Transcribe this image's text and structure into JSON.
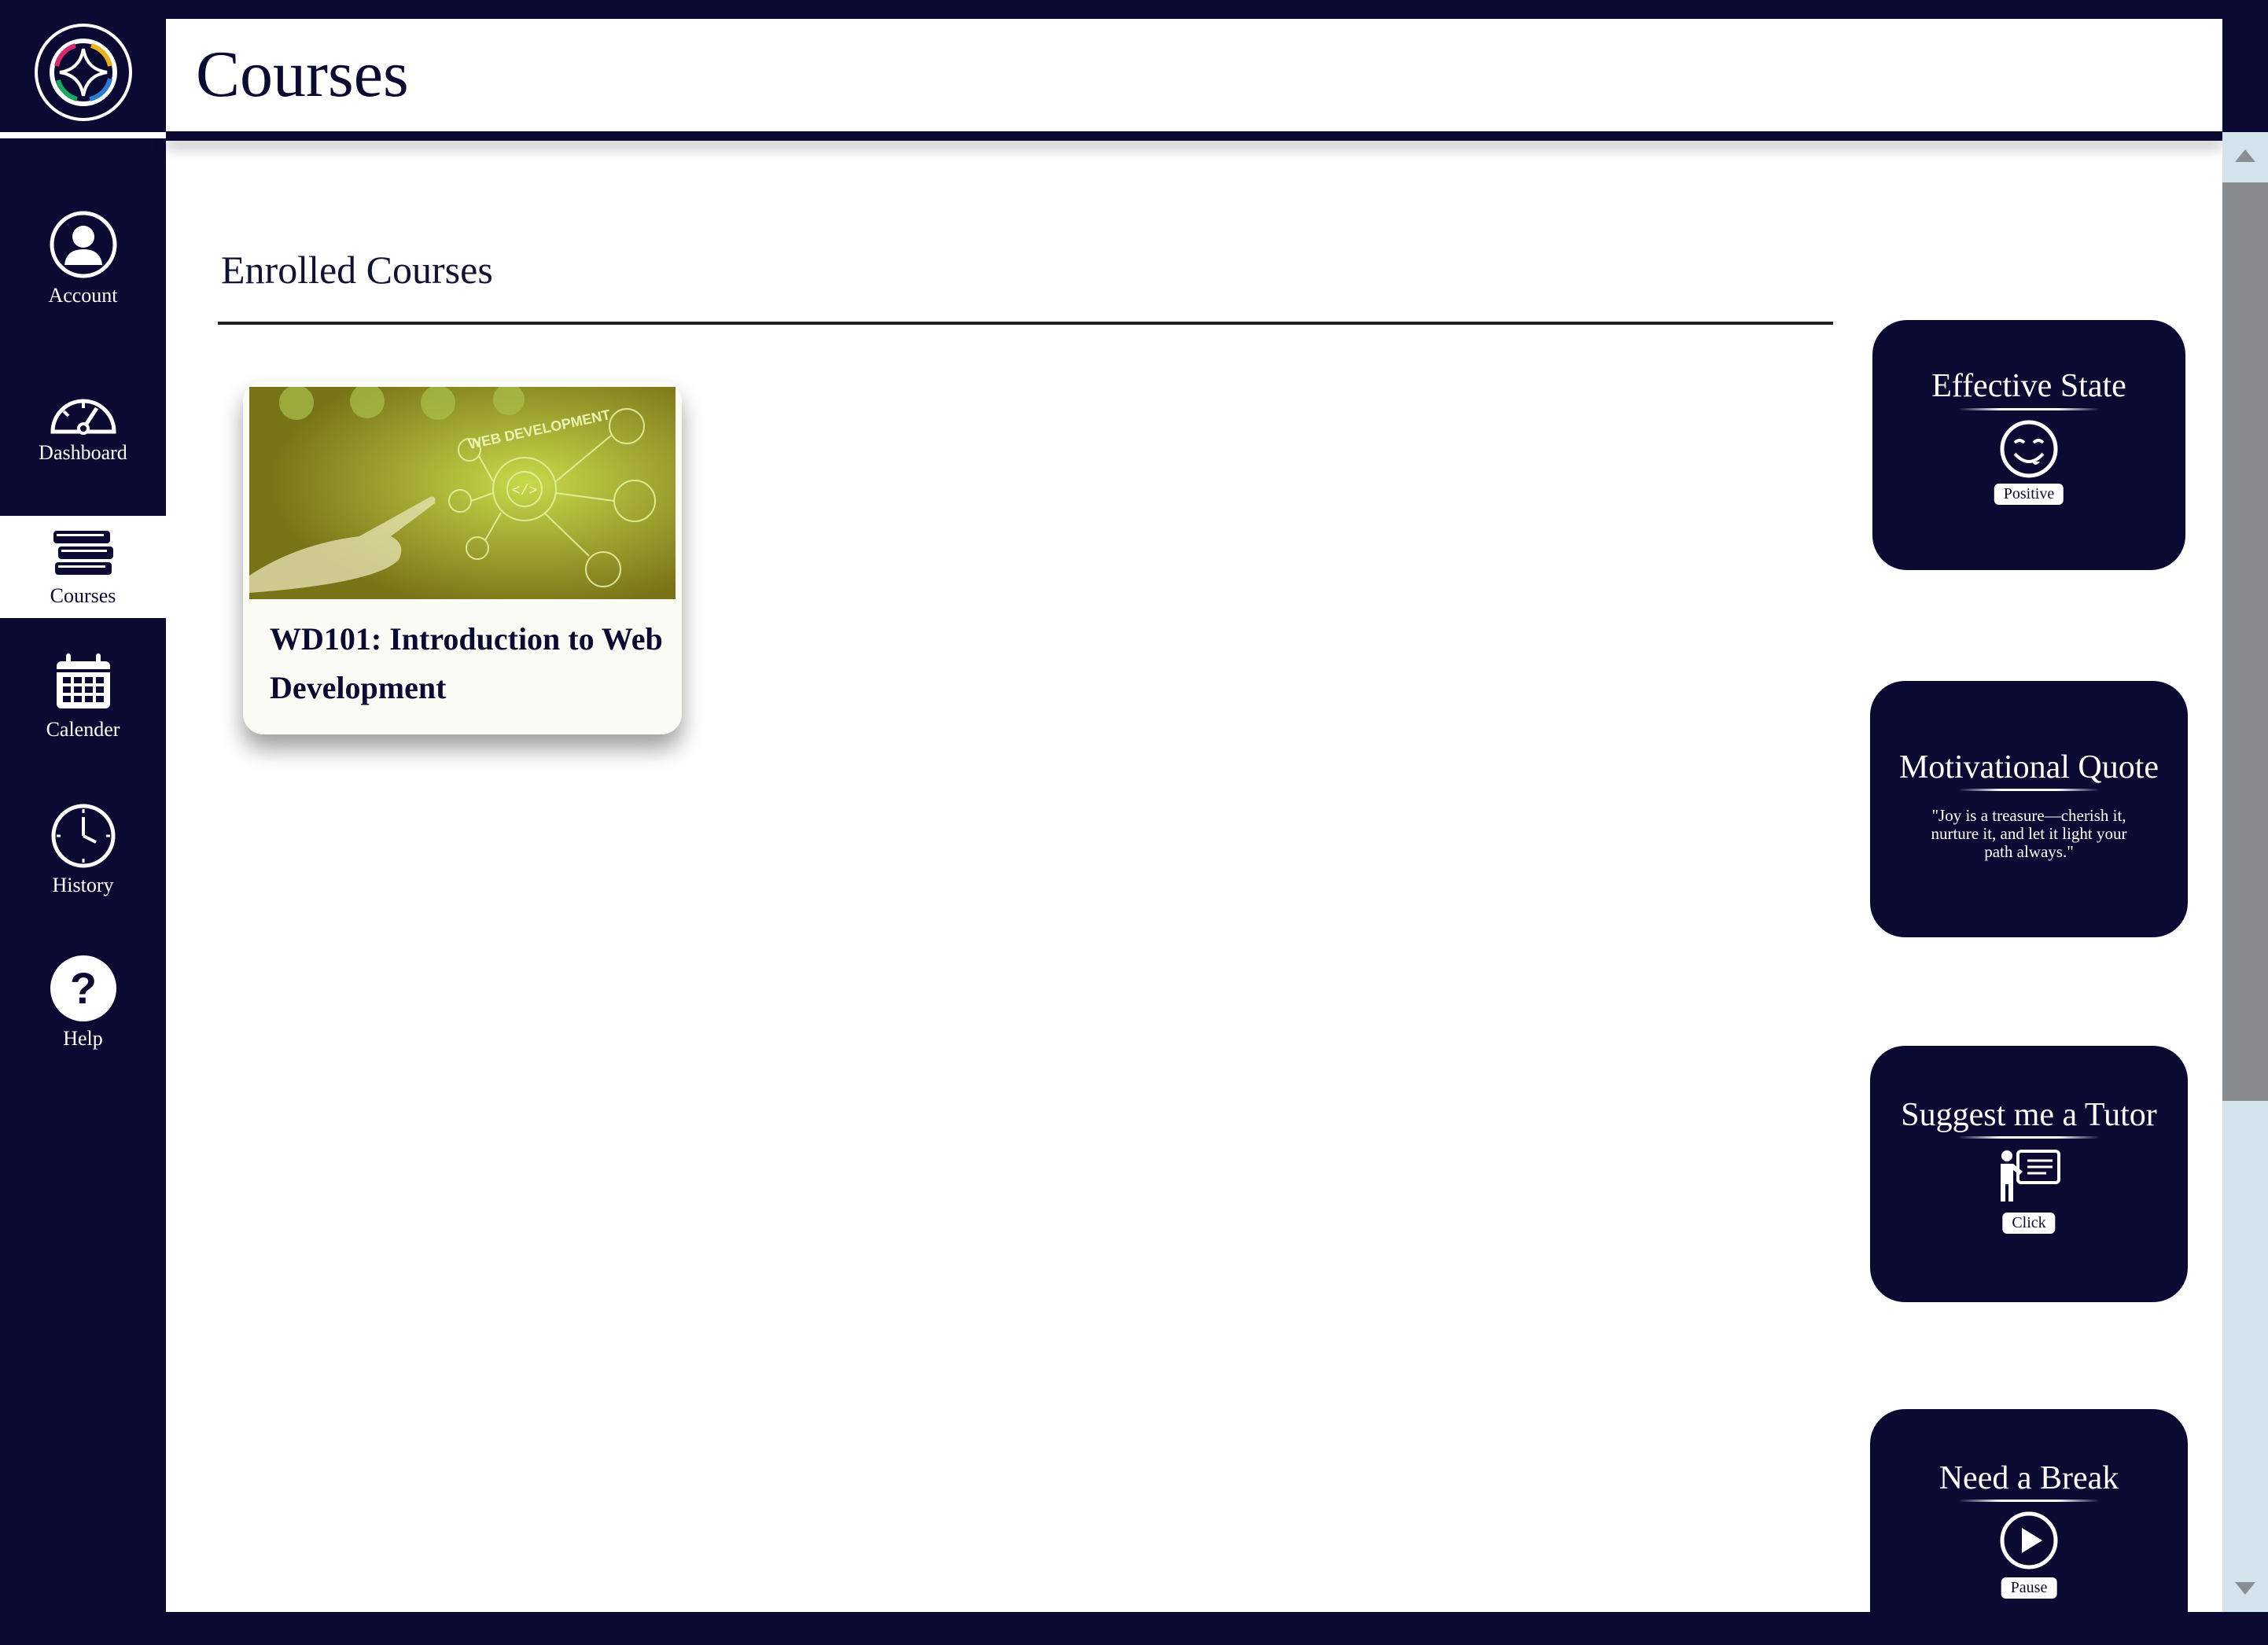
{
  "header": {
    "title": "Courses"
  },
  "sidebar": {
    "items": [
      {
        "label": "Account",
        "icon": "account-icon"
      },
      {
        "label": "Dashboard",
        "icon": "dashboard-gauge-icon"
      },
      {
        "label": "Courses",
        "icon": "books-icon",
        "active": true
      },
      {
        "label": "Calender",
        "icon": "calendar-icon"
      },
      {
        "label": "History",
        "icon": "clock-icon"
      },
      {
        "label": "Help",
        "icon": "help-icon"
      }
    ]
  },
  "main": {
    "section_title": "Enrolled Courses",
    "courses": [
      {
        "title": "WD101: Introduction to Web Development",
        "image_text": "WEB DEVELOPMENT"
      }
    ]
  },
  "widgets": {
    "effective_state": {
      "title": "Effective State",
      "icon": "smiley-icon",
      "button": "Positive"
    },
    "motivational_quote": {
      "title": "Motivational Quote",
      "quote": "\"Joy is a treasure—cherish it, nurture it, and let it light your path always.\""
    },
    "suggest_tutor": {
      "title": "Suggest me a Tutor",
      "icon": "tutor-icon",
      "button": "Click"
    },
    "need_break": {
      "title": "Need a Break",
      "icon": "play-icon",
      "button": "Pause"
    }
  },
  "colors": {
    "navy": "#0b0a33",
    "white": "#ffffff",
    "course_image_tint": "#8b8520",
    "scrollbar_track": "#d4e4ec",
    "scrollbar_thumb": "#878b90"
  }
}
